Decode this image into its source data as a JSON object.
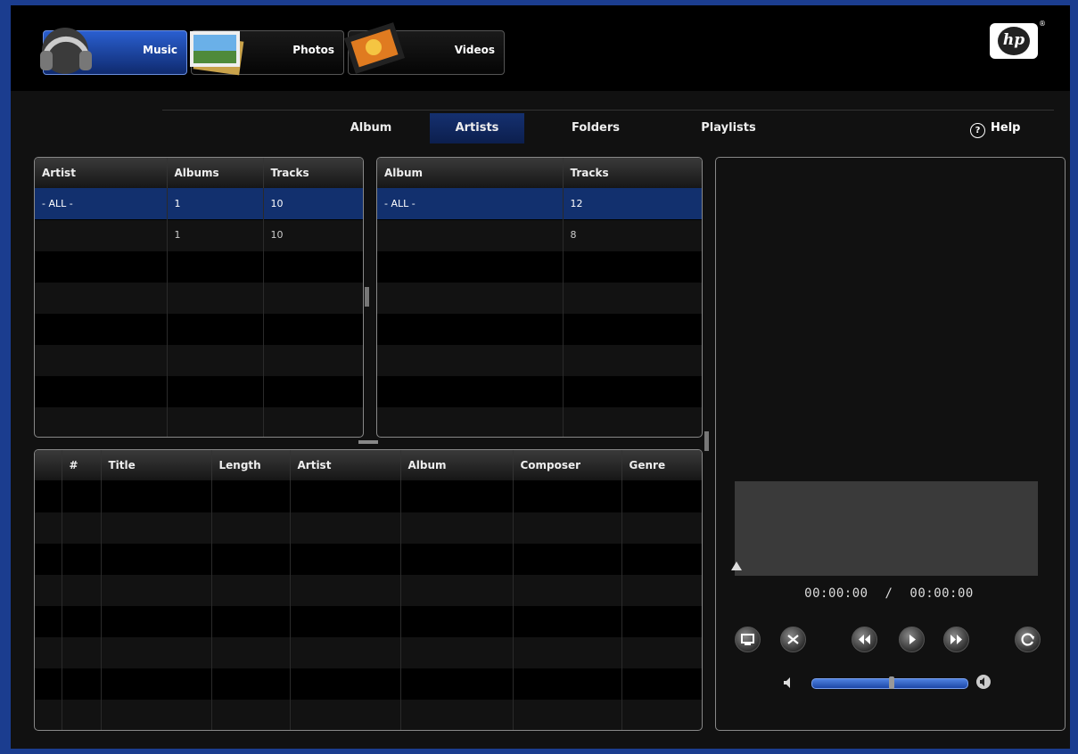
{
  "topbar": {
    "tabs": [
      {
        "label": "Music",
        "icon": "headphones-icon",
        "active": true
      },
      {
        "label": "Photos",
        "icon": "photos-icon",
        "active": false
      },
      {
        "label": "Videos",
        "icon": "film-icon",
        "active": false
      }
    ],
    "logo_text": "hp",
    "logo_reg": "®"
  },
  "subnav": {
    "tabs": [
      {
        "label": "Album",
        "active": false
      },
      {
        "label": "Artists",
        "active": true
      },
      {
        "label": "Folders",
        "active": false
      },
      {
        "label": "Playlists",
        "active": false
      }
    ],
    "help_icon": "?",
    "help_label": "Help"
  },
  "artists_table": {
    "headers": [
      "Artist",
      "Albums",
      "Tracks"
    ],
    "rows": [
      [
        "- ALL -",
        "1",
        "10"
      ],
      [
        "",
        "1",
        "10"
      ]
    ]
  },
  "albums_table": {
    "headers": [
      "Album",
      "Tracks"
    ],
    "rows": [
      [
        "- ALL -",
        "12"
      ],
      [
        "",
        "8"
      ]
    ]
  },
  "tracks_table": {
    "headers": [
      "",
      "#",
      "Title",
      "Length",
      "Artist",
      "Album",
      "Composer",
      "Genre"
    ]
  },
  "player": {
    "current_time": "00:00:00",
    "separator": "/",
    "total_time": "00:00:00",
    "volume_level": 0.52
  },
  "colors": {
    "accent": "#12306e",
    "frame": "#1b3d8f"
  }
}
